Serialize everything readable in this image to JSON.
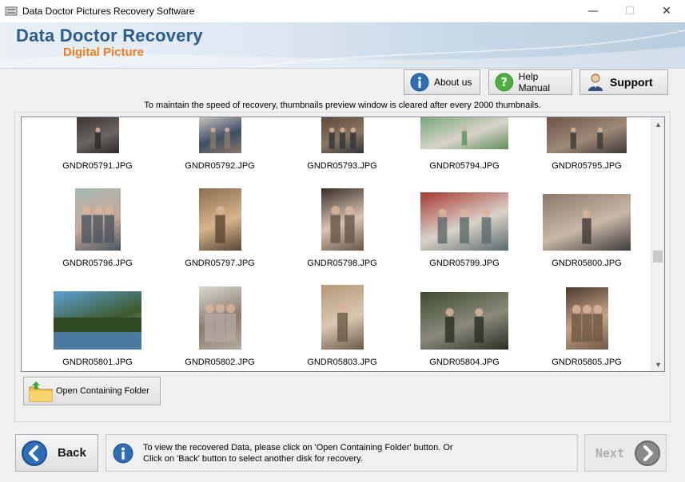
{
  "window": {
    "title": "Data Doctor Pictures Recovery Software",
    "minimize": "—",
    "maximize": "☐",
    "close": "✕"
  },
  "banner": {
    "title": "Data Doctor Recovery",
    "subtitle": "Digital Picture"
  },
  "toolbar": {
    "about_label": "About us",
    "help_label": "Help Manual",
    "support_label": "Support"
  },
  "notice": "To maintain the speed of recovery, thumbnails preview window is cleared after every 2000 thumbnails.",
  "thumbnails": [
    {
      "name": "GNDR05791.JPG",
      "colors": [
        "#3a3530",
        "#6b6560",
        "#2a2a2a"
      ]
    },
    {
      "name": "GNDR05792.JPG",
      "colors": [
        "#c9c4bd",
        "#3f4e66",
        "#8a7a68"
      ]
    },
    {
      "name": "GNDR05793.JPG",
      "colors": [
        "#5a4a3c",
        "#8b7560",
        "#30343a"
      ]
    },
    {
      "name": "GNDR05794.JPG",
      "colors": [
        "#7aa67a",
        "#d8d4c9",
        "#5e8c5a"
      ]
    },
    {
      "name": "GNDR05795.JPG",
      "colors": [
        "#6b5446",
        "#9e8876",
        "#3c3a36"
      ]
    },
    {
      "name": "GNDR05796.JPG",
      "colors": [
        "#a7b8b4",
        "#c8a898",
        "#4a5660"
      ]
    },
    {
      "name": "GNDR05797.JPG",
      "colors": [
        "#8b6d4e",
        "#d6b48c",
        "#5b4634"
      ]
    },
    {
      "name": "GNDR05798.JPG",
      "colors": [
        "#3a2e26",
        "#d8c4b4",
        "#6a5444"
      ]
    },
    {
      "name": "GNDR05799.JPG",
      "colors": [
        "#a63a32",
        "#d9d2c8",
        "#5b6a6c"
      ]
    },
    {
      "name": "GNDR05800.JPG",
      "colors": [
        "#8a7868",
        "#c9b8a6",
        "#3d3a38"
      ]
    },
    {
      "name": "GNDR05801.JPG",
      "colors": [
        "#5ea0d8",
        "#3c5a2a",
        "#b9d4e8"
      ]
    },
    {
      "name": "GNDR05802.JPG",
      "colors": [
        "#d8d8d2",
        "#8a7a6c",
        "#b4aaa0"
      ]
    },
    {
      "name": "GNDR05803.JPG",
      "colors": [
        "#b49878",
        "#d8c8b0",
        "#6a5a48"
      ]
    },
    {
      "name": "GNDR05804.JPG",
      "colors": [
        "#3e4a30",
        "#8a8a7a",
        "#2a2e22"
      ]
    },
    {
      "name": "GNDR05805.JPG",
      "colors": [
        "#4a3a2c",
        "#c9a48a",
        "#6e5844"
      ]
    }
  ],
  "open_folder_label": "Open Containing Folder",
  "footer": {
    "back_label": "Back",
    "message_line1": "To view the recovered Data, please click on 'Open Containing Folder' button. Or",
    "message_line2": "Click on 'Back' button to select another disk for recovery.",
    "next_label": "Next"
  },
  "colors": {
    "brand_blue": "#2d5b8d",
    "brand_orange": "#f07d20",
    "icon_blue": "#2f6db5",
    "icon_green": "#4caf3e"
  }
}
